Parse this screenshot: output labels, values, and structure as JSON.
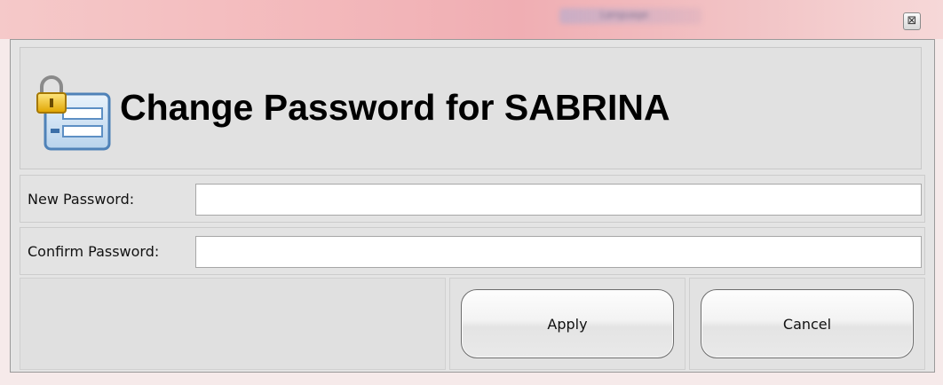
{
  "window": {
    "background_tab_label": "Language",
    "close_glyph": "⊠",
    "close_icon": "close-icon"
  },
  "header": {
    "title": "Change Password for SABRINA",
    "icon": "lock-form-icon"
  },
  "form": {
    "new_password_label": "New Password:",
    "new_password_value": "",
    "confirm_password_label": "Confirm Password:",
    "confirm_password_value": ""
  },
  "buttons": {
    "apply_label": "Apply",
    "cancel_label": "Cancel"
  },
  "colors": {
    "titlebar": "#f3b8bb",
    "dialog_bg": "#e4e4e4",
    "input_bg": "#ffffff"
  }
}
